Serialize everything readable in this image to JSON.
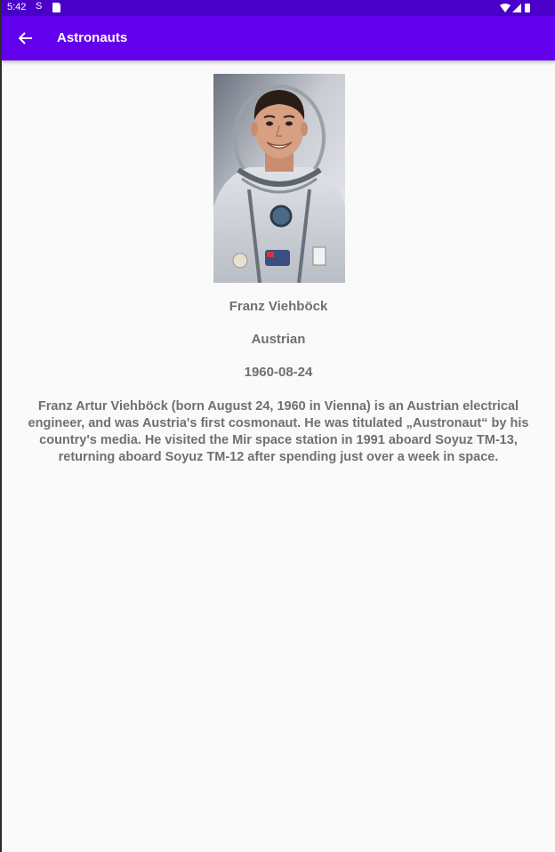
{
  "status_bar": {
    "time": "5:42",
    "s_icon": "S",
    "icons": [
      "s-notification-icon",
      "sd-card-icon",
      "wifi-icon",
      "signal-icon",
      "battery-icon"
    ]
  },
  "app_bar": {
    "title": "Astronauts",
    "back_icon": "arrow-left-icon",
    "color": "#6200ee"
  },
  "astronaut": {
    "photo_icon": "astronaut-photo",
    "name": "Franz Viehböck",
    "nationality": "Austrian",
    "date_of_birth": "1960-08-24",
    "bio": "Franz Artur Viehböck (born August 24, 1960 in Vienna) is an Austrian electrical engineer, and was Austria's first cosmonaut. He was titulated „Austronaut“ by his country's media. He visited the Mir space station in 1991 aboard Soyuz TM-13, returning aboard Soyuz TM-12 after spending just over a week in space."
  },
  "colors": {
    "status_bar": "#4a00c8",
    "background": "#fafafa",
    "text": "#707070"
  }
}
